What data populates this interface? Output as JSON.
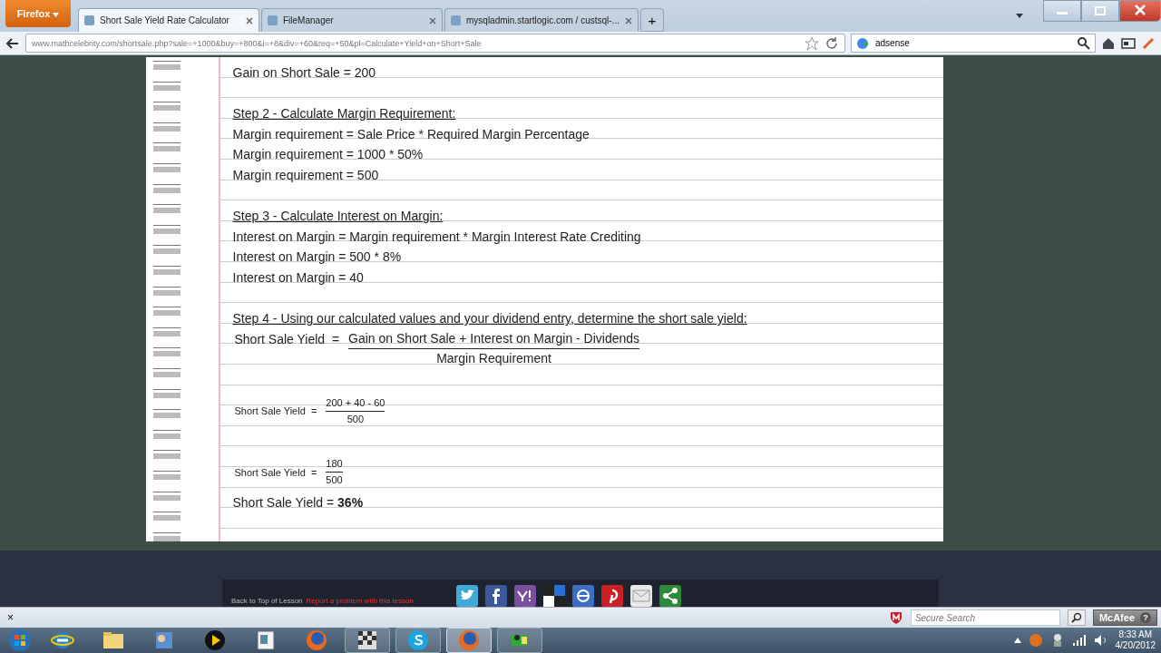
{
  "browser": {
    "menu_button": "Firefox",
    "tabs": [
      {
        "title": "Short Sale Yield Rate Calculator",
        "selected": true
      },
      {
        "title": "FileManager",
        "selected": false
      },
      {
        "title": "mysqladmin.startlogic.com / custsql-...",
        "selected": false
      }
    ],
    "new_tab": "+",
    "url": "www.mathcelebrity.com/shortsale.php?sale=+1000&buy=+800&i=+8&div=+60&req=+50&pl=Calculate+Yield+on+Short+Sale",
    "search": "adsense"
  },
  "lesson": {
    "lines": [
      {
        "kind": "text",
        "text": "Gain on Short Sale = 200"
      },
      {
        "kind": "blank"
      },
      {
        "kind": "step",
        "text": "Step 2 - Calculate Margin Requirement:"
      },
      {
        "kind": "text",
        "text": "Margin requirement = Sale Price * Required Margin Percentage"
      },
      {
        "kind": "text",
        "text": "Margin requirement = 1000 * 50%"
      },
      {
        "kind": "text",
        "text": "Margin requirement = 500"
      },
      {
        "kind": "blank"
      },
      {
        "kind": "step",
        "text": "Step 3 - Calculate Interest on Margin:"
      },
      {
        "kind": "text",
        "text": "Interest on Margin = Margin requirement * Margin Interest Rate Crediting"
      },
      {
        "kind": "text",
        "text": "Interest on Margin = 500 * 8%"
      },
      {
        "kind": "text",
        "text": "Interest on Margin = 40"
      },
      {
        "kind": "blank"
      },
      {
        "kind": "step",
        "text": "Step 4 - Using our calculated values and your dividend entry, determine the short sale yield:"
      },
      {
        "kind": "fraction",
        "label": "Short Sale Yield  =",
        "numerator": "Gain on Short Sale + Interest on Margin - Dividends",
        "denominator": "Margin Requirement"
      },
      {
        "kind": "blank"
      },
      {
        "kind": "small_fraction",
        "label": "Short Sale Yield  =",
        "numerator": "200 + 40 - 60",
        "denominator": "500"
      },
      {
        "kind": "blank"
      },
      {
        "kind": "small_fraction",
        "label": "Short Sale Yield  =",
        "numerator": "180",
        "denominator": "500"
      },
      {
        "kind": "text",
        "text": "Short Sale Yield = **36%**"
      }
    ]
  },
  "footer": {
    "back_link": "Back to Top of Lesson",
    "report_link": "Report a problem with this lesson",
    "share": [
      {
        "kind": "twitter"
      },
      {
        "kind": "facebook"
      },
      {
        "kind": "yahoo"
      },
      {
        "kind": "delicious"
      },
      {
        "kind": "live"
      },
      {
        "kind": "pinterest"
      },
      {
        "kind": "email"
      },
      {
        "kind": "share"
      }
    ]
  },
  "toolbar": {
    "close": "×",
    "search_placeholder": "Secure Search",
    "brand": "McAfee",
    "help": "?"
  },
  "taskbar": {
    "apps": [
      {
        "kind": "ie"
      },
      {
        "kind": "folder"
      },
      {
        "kind": "paint"
      },
      {
        "kind": "player"
      },
      {
        "kind": "doc"
      },
      {
        "kind": "firefox"
      },
      {
        "kind": "checker",
        "selected": false
      },
      {
        "kind": "skype",
        "selected": false
      },
      {
        "kind": "firefox",
        "selected": true
      },
      {
        "kind": "camera",
        "selected": false
      }
    ],
    "time": "8:33 AM",
    "date": "4/20/2012"
  }
}
